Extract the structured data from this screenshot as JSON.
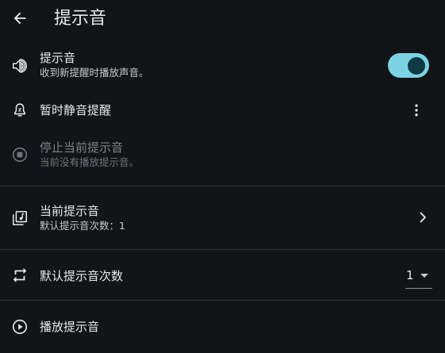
{
  "header": {
    "title": "提示音",
    "back_icon": "arrow-back-icon"
  },
  "settings": [
    {
      "id": "alert-sound",
      "icon": "volume-icon",
      "title": "提示音",
      "subtitle": "收到新提醒时播放声音。",
      "control": "toggle",
      "toggle_on": true
    },
    {
      "id": "snooze",
      "icon": "alarm-snooze-icon",
      "title": "暂时静音提醒",
      "control": "more",
      "more_icon": "more-vert-icon"
    },
    {
      "id": "stop-current",
      "icon": "stop-circle-icon",
      "title": "停止当前提示音",
      "subtitle": "当前没有播放提示音。",
      "disabled": true
    },
    {
      "id": "current-sound",
      "icon": "music-library-icon",
      "title": "当前提示音",
      "subtitle": "默认提示音次数：1",
      "control": "chevron",
      "chevron_icon": "chevron-right-icon"
    },
    {
      "id": "default-repeat",
      "icon": "repeat-icon",
      "title": "默认提示音次数",
      "control": "dropdown",
      "dropdown_value": "1"
    },
    {
      "id": "play-sound",
      "icon": "play-circle-icon",
      "title": "播放提示音"
    }
  ],
  "colors": {
    "background": "#111518",
    "accent": "#7cd3e3",
    "toggle_knob": "#0f3a44",
    "divider": "#33383c"
  }
}
